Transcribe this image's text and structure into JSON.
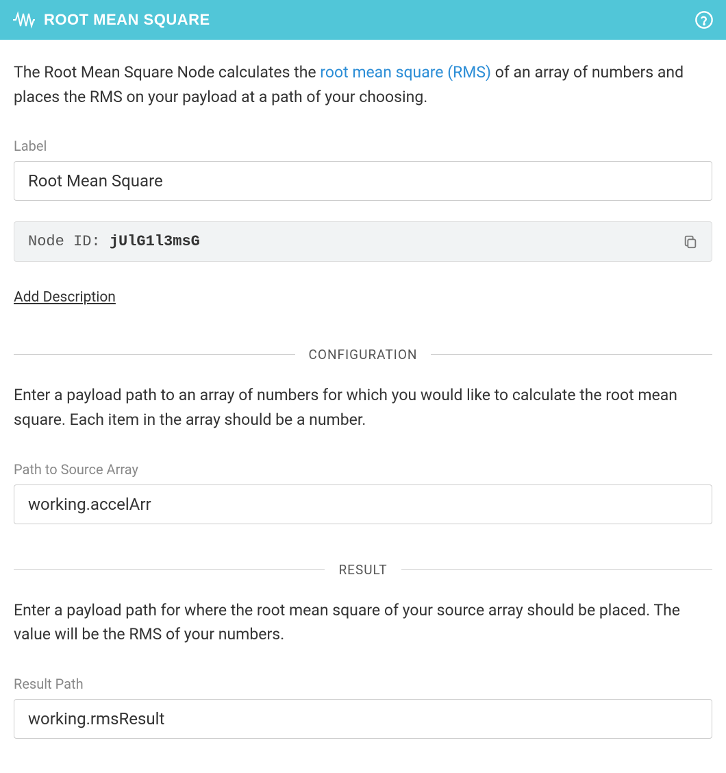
{
  "header": {
    "title": "ROOT MEAN SQUARE"
  },
  "intro": {
    "text_before_link": "The Root Mean Square Node calculates the ",
    "link_text": "root mean square (RMS)",
    "text_after_link": " of an array of numbers and places the RMS on your payload at a path of your choosing."
  },
  "label_field": {
    "label": "Label",
    "value": "Root Mean Square"
  },
  "node_id": {
    "label": "Node ID: ",
    "value": "jUlG1l3msG"
  },
  "add_description": "Add Description",
  "sections": {
    "configuration": {
      "title": "CONFIGURATION",
      "description": "Enter a payload path to an array of numbers for which you would like to calculate the root mean square. Each item in the array should be a number.",
      "field_label": "Path to Source Array",
      "field_value": "working.accelArr"
    },
    "result": {
      "title": "RESULT",
      "description": "Enter a payload path for where the root mean square of your source array should be placed. The value will be the RMS of your numbers.",
      "field_label": "Result Path",
      "field_value": "working.rmsResult"
    }
  }
}
